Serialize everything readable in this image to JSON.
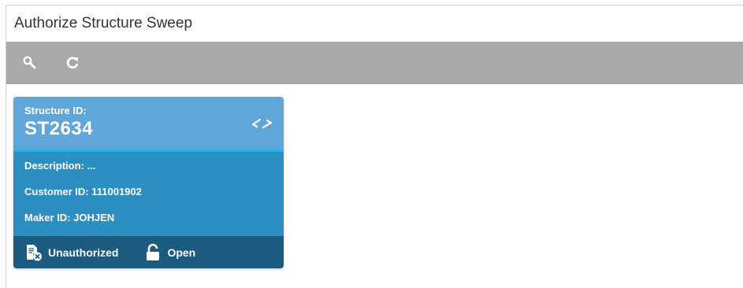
{
  "page": {
    "title": "Authorize Structure Sweep"
  },
  "toolbar": {
    "search_icon": "search-icon",
    "refresh_icon": "refresh-icon"
  },
  "tile": {
    "structure_id_label": "Structure ID:",
    "structure_id_value": "ST2634",
    "swap_icon": "swap-arrows-icon",
    "description": "Description: ...",
    "customer_id": "Customer ID:  111001902",
    "maker_id": "Maker ID:  JOHJEN",
    "auth_status": "Unauthorized",
    "auth_icon": "unauthorized-document-icon",
    "record_status": "Open",
    "record_icon": "unlock-icon"
  },
  "colors": {
    "toolbar": "#a9a9a9",
    "tile_top": "#5ea7d8",
    "tile_accent": "#27b0e6",
    "tile_body": "#2b8fc1",
    "tile_footer": "#1a5b7f"
  }
}
